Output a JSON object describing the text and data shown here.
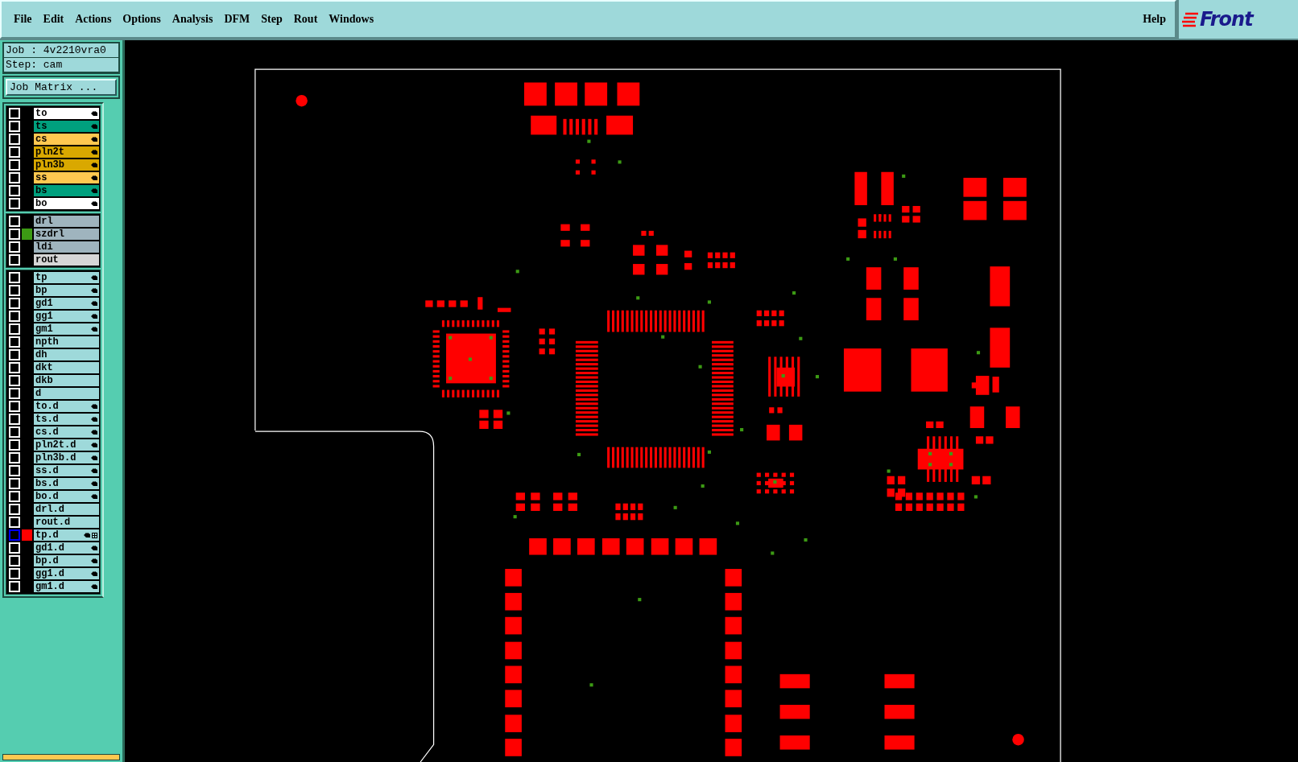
{
  "menu_bar": {
    "items": [
      "File",
      "Edit",
      "Actions",
      "Options",
      "Analysis",
      "DFM",
      "Step",
      "Rout",
      "Windows"
    ],
    "help": "Help",
    "logo": "Front"
  },
  "sidebar": {
    "job": "Job : 4v2210vra0",
    "step": "Step: cam",
    "job_matrix_button": "Job Matrix ...",
    "layer_groups": [
      {
        "layers": [
          {
            "name": "to",
            "color": "#ffffff",
            "board": true,
            "selected": false
          },
          {
            "name": "ts",
            "color": "#00a07e",
            "board": true,
            "selected": false
          },
          {
            "name": "cs",
            "color": "#ffc850",
            "board": true,
            "selected": false
          },
          {
            "name": "pln2t",
            "color": "#d9a800",
            "board": true,
            "selected": false
          },
          {
            "name": "pln3b",
            "color": "#d9a800",
            "board": true,
            "selected": false
          },
          {
            "name": "ss",
            "color": "#ffc850",
            "board": true,
            "selected": false
          },
          {
            "name": "bs",
            "color": "#00a07e",
            "board": true,
            "selected": false
          },
          {
            "name": "bo",
            "color": "#ffffff",
            "board": true,
            "selected": false
          }
        ]
      },
      {
        "layers": [
          {
            "name": "drl",
            "color": "#9fb4be",
            "board": false,
            "selected": false
          },
          {
            "name": "szdrl",
            "color": "#9fb4be",
            "board": false,
            "selected": false,
            "display": {
              "color": "#3c9a14"
            }
          },
          {
            "name": "ldi",
            "color": "#9fb4be",
            "board": false,
            "selected": false
          },
          {
            "name": "rout",
            "color": "#d6d6d6",
            "board": false,
            "selected": false
          }
        ]
      },
      {
        "layers": [
          {
            "name": "tp",
            "color": "#9ed9da",
            "board": true,
            "selected": false
          },
          {
            "name": "bp",
            "color": "#9ed9da",
            "board": true,
            "selected": false
          },
          {
            "name": "gd1",
            "color": "#9ed9da",
            "board": true,
            "selected": false
          },
          {
            "name": "gg1",
            "color": "#9ed9da",
            "board": true,
            "selected": false
          },
          {
            "name": "gm1",
            "color": "#9ed9da",
            "board": true,
            "selected": false
          },
          {
            "name": "npth",
            "color": "#9ed9da",
            "board": false,
            "selected": false
          },
          {
            "name": "dh",
            "color": "#9ed9da",
            "board": false,
            "selected": false
          },
          {
            "name": "dkt",
            "color": "#9ed9da",
            "board": false,
            "selected": false
          },
          {
            "name": "dkb",
            "color": "#9ed9da",
            "board": false,
            "selected": false
          },
          {
            "name": "d",
            "color": "#9ed9da",
            "board": false,
            "selected": false
          },
          {
            "name": "to.d",
            "color": "#9ed9da",
            "board": true,
            "selected": false
          },
          {
            "name": "ts.d",
            "color": "#9ed9da",
            "board": true,
            "selected": false
          },
          {
            "name": "cs.d",
            "color": "#9ed9da",
            "board": true,
            "selected": false
          },
          {
            "name": "pln2t.d",
            "color": "#9ed9da",
            "board": true,
            "selected": false
          },
          {
            "name": "pln3b.d",
            "color": "#9ed9da",
            "board": true,
            "selected": false
          },
          {
            "name": "ss.d",
            "color": "#9ed9da",
            "board": true,
            "selected": false
          },
          {
            "name": "bs.d",
            "color": "#9ed9da",
            "board": true,
            "selected": false
          },
          {
            "name": "bo.d",
            "color": "#9ed9da",
            "board": true,
            "selected": false
          },
          {
            "name": "drl.d",
            "color": "#9ed9da",
            "board": false,
            "selected": false
          },
          {
            "name": "rout.d",
            "color": "#9ed9da",
            "board": false,
            "selected": false
          },
          {
            "name": "tp.d",
            "color": "#9ed9da",
            "board": true,
            "selected": true,
            "display": {
              "color": "#ff0000"
            }
          },
          {
            "name": "gd1.d",
            "color": "#9ed9da",
            "board": true,
            "selected": false
          },
          {
            "name": "bp.d",
            "color": "#9ed9da",
            "board": true,
            "selected": false
          },
          {
            "name": "gg1.d",
            "color": "#9ed9da",
            "board": true,
            "selected": false
          },
          {
            "name": "gm1.d",
            "color": "#9ed9da",
            "board": true,
            "selected": false
          }
        ]
      }
    ]
  }
}
